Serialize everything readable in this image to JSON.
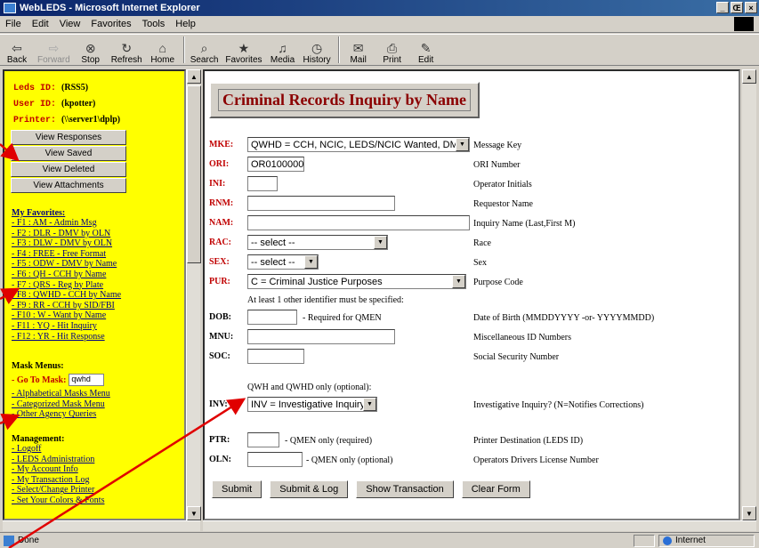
{
  "window": {
    "title": "WebLEDS - Microsoft Internet Explorer",
    "min": "_",
    "max": "Œ",
    "close": "×"
  },
  "menu": [
    "File",
    "Edit",
    "View",
    "Favorites",
    "Tools",
    "Help"
  ],
  "toolbar": [
    {
      "label": "Back",
      "icon": "⇦"
    },
    {
      "label": "Forward",
      "icon": "⇨"
    },
    {
      "label": "Stop",
      "icon": "⊗"
    },
    {
      "label": "Refresh",
      "icon": "↻"
    },
    {
      "label": "Home",
      "icon": "⌂"
    },
    {
      "label": "Search",
      "icon": "⌕"
    },
    {
      "label": "Favorites",
      "icon": "★"
    },
    {
      "label": "Media",
      "icon": "♫"
    },
    {
      "label": "History",
      "icon": "◷"
    },
    {
      "label": "Mail",
      "icon": "✉"
    },
    {
      "label": "Print",
      "icon": "⎙"
    },
    {
      "label": "Edit",
      "icon": "✎"
    }
  ],
  "sidebar": {
    "leds_label": "Leds ID:",
    "leds_val": "(RSS5)",
    "user_label": "User ID:",
    "user_val": "(kpotter)",
    "printer_label": "Printer:",
    "printer_val": "(\\\\server1\\dplp)",
    "buttons": [
      "View Responses",
      "View Saved",
      "View Deleted",
      "View Attachments"
    ],
    "favorites_title": "My Favorites:",
    "favorites": [
      "- F1 : AM - Admin Msg",
      "- F2 : DLR - DMV by OLN",
      "- F3 : DLW - DMV by OLN",
      "- F4 : FREE - Free Format",
      "- F5 : ODW - DMV by Name",
      "- F6 : QH - CCH by Name",
      "- F7 : QRS - Reg by Plate",
      "- F8 : QWHD - CCH by Name",
      "- F9 : RR - CCH by SID/FBI",
      "- F10 : W - Want by Name",
      "- F11 : YQ - Hit Inquiry",
      "- F12 : YR - Hit Response"
    ],
    "mask_title": "Mask Menus:",
    "goto_label": "- Go To Mask:",
    "goto_value": "qwhd",
    "mask_links": [
      "- Alphabetical Masks Menu",
      "- Categorized Mask Menu",
      "- Other Agency Queries"
    ],
    "mgmt_title": "Management:",
    "mgmt_links": [
      "- Logoff",
      "- LEDS Administration",
      "- My Account Info",
      "- My Transaction Log",
      "- Select/Change Printer",
      "- Set Your Colors & Fonts"
    ]
  },
  "form": {
    "title": "Criminal Records Inquiry by Name",
    "mke": {
      "label": "MKE:",
      "value": "QWHD = CCH, NCIC, LEDS/NCIC Wanted, DMV",
      "desc": "Message Key"
    },
    "ori": {
      "label": "ORI:",
      "value": "OR0100000",
      "desc": "ORI Number"
    },
    "ini": {
      "label": "INI:",
      "value": "",
      "desc": "Operator Initials"
    },
    "rnm": {
      "label": "RNM:",
      "value": "",
      "desc": "Requestor Name"
    },
    "nam": {
      "label": "NAM:",
      "value": "",
      "desc": "Inquiry Name (Last,First M)"
    },
    "rac": {
      "label": "RAC:",
      "value": "-- select --",
      "desc": "Race"
    },
    "sex": {
      "label": "SEX:",
      "value": "-- select --",
      "desc": "Sex"
    },
    "pur": {
      "label": "PUR:",
      "value": "C = Criminal Justice Purposes",
      "desc": "Purpose Code"
    },
    "note1": "At least 1 other identifier must be specified:",
    "dob": {
      "label": "DOB:",
      "value": "",
      "note": "- Required for QMEN",
      "desc": "Date of Birth (MMDDYYYY -or- YYYYMMDD)"
    },
    "mnu": {
      "label": "MNU:",
      "value": "",
      "desc": "Miscellaneous ID Numbers"
    },
    "soc": {
      "label": "SOC:",
      "value": "",
      "desc": "Social Security Number"
    },
    "note2": "QWH and QWHD only (optional):",
    "inv": {
      "label": "INV:",
      "value": "INV = Investigative Inquiry",
      "desc": "Investigative Inquiry? (N=Notifies Corrections)"
    },
    "ptr": {
      "label": "PTR:",
      "value": "",
      "note": "- QMEN only (required)",
      "desc": "Printer Destination (LEDS ID)"
    },
    "oln": {
      "label": "OLN:",
      "value": "",
      "note": "- QMEN only (optional)",
      "desc": "Operators Drivers License Number"
    },
    "buttons": {
      "submit": "Submit",
      "submit_log": "Submit & Log",
      "show": "Show Transaction",
      "clear": "Clear Form"
    }
  },
  "status": {
    "text": "Done",
    "zone": "Internet"
  },
  "colors": {
    "sidebar_bg": "#ffff00",
    "label_red": "#c00000",
    "title_red": "#8b0000",
    "annotation_arrow": "#e00000"
  }
}
